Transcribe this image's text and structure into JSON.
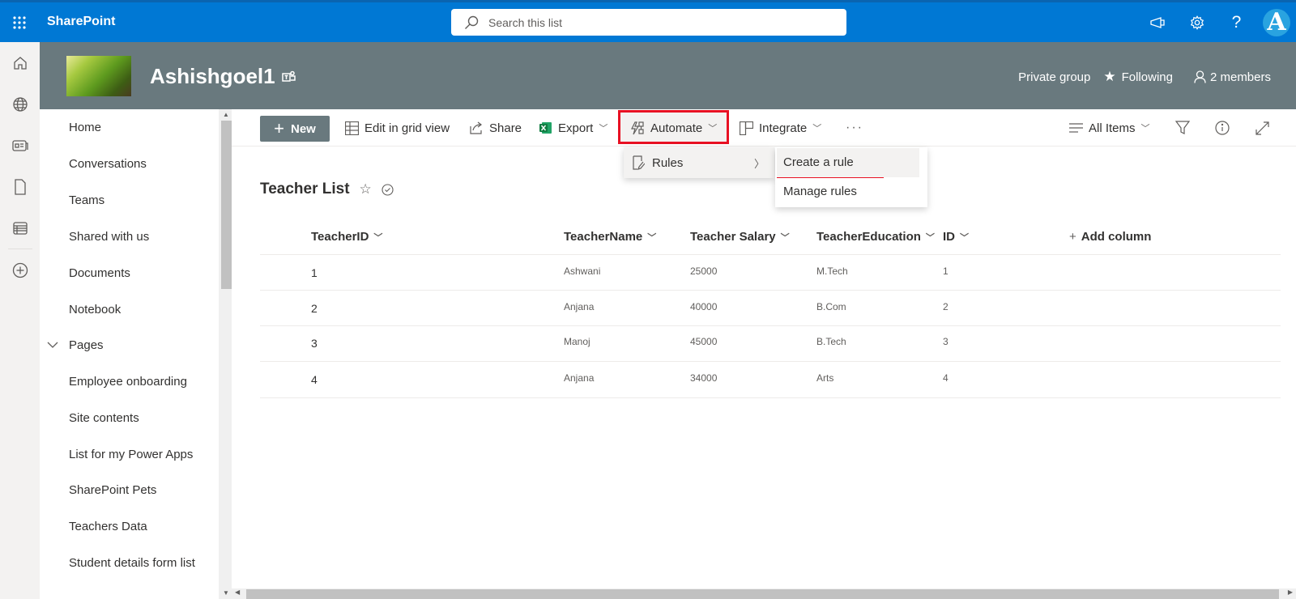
{
  "suite": {
    "brand": "SharePoint",
    "search_placeholder": "Search this list",
    "avatar_initial": "A"
  },
  "site": {
    "title": "Ashishgoel1",
    "privacy": "Private group",
    "following": "Following",
    "members": "2 members"
  },
  "nav": {
    "items": [
      {
        "label": "Home"
      },
      {
        "label": "Conversations"
      },
      {
        "label": "Teams"
      },
      {
        "label": "Shared with us"
      },
      {
        "label": "Documents"
      },
      {
        "label": "Notebook"
      },
      {
        "label": "Pages"
      },
      {
        "label": "Employee onboarding"
      },
      {
        "label": "Site contents"
      },
      {
        "label": "List for my Power Apps"
      },
      {
        "label": "SharePoint Pets"
      },
      {
        "label": "Teachers Data"
      },
      {
        "label": "Student details form list"
      }
    ]
  },
  "toolbar": {
    "new": "New",
    "edit_grid": "Edit in grid view",
    "share": "Share",
    "export": "Export",
    "automate": "Automate",
    "integrate": "Integrate",
    "more": "···",
    "view": "All Items"
  },
  "automate_menu": {
    "rules": "Rules",
    "create_rule": "Create a rule",
    "manage_rules": "Manage rules"
  },
  "list": {
    "title": "Teacher List",
    "columns": [
      "TeacherID",
      "TeacherName",
      "Teacher Salary",
      "TeacherEducation",
      "ID"
    ],
    "add_column": "Add column",
    "rows": [
      [
        "1",
        "Ashwani",
        "25000",
        "M.Tech",
        "1"
      ],
      [
        "2",
        "Anjana",
        "40000",
        "B.Com",
        "2"
      ],
      [
        "3",
        "Manoj",
        "45000",
        "B.Tech",
        "3"
      ],
      [
        "4",
        "Anjana",
        "34000",
        "Arts",
        "4"
      ]
    ]
  }
}
